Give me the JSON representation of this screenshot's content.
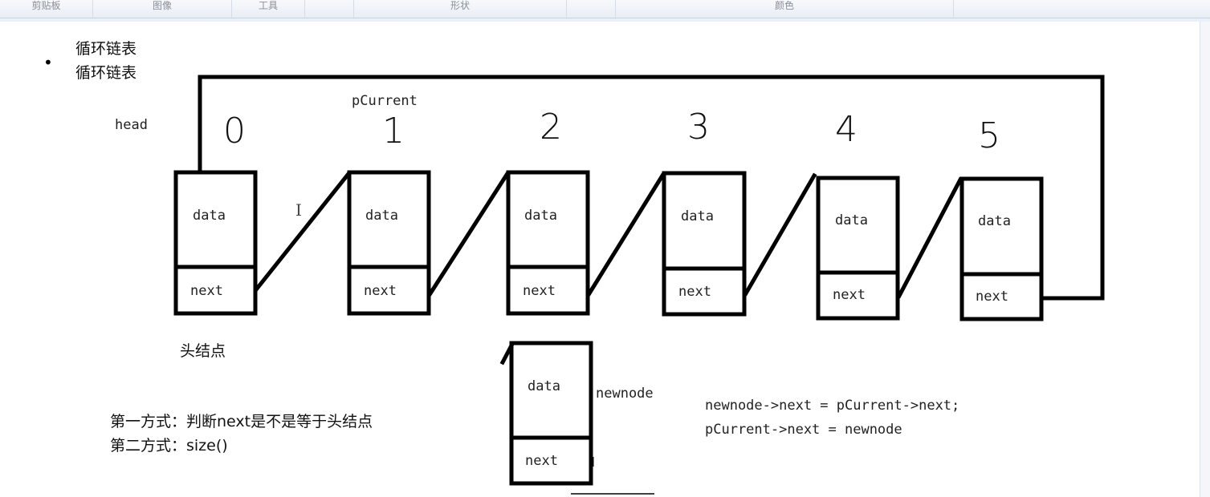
{
  "toolbar": {
    "groups": [
      {
        "label": "剪贴板"
      },
      {
        "label": "图像"
      },
      {
        "label": "工具"
      },
      {
        "label": ""
      },
      {
        "label": "形状"
      },
      {
        "label": ""
      },
      {
        "label": "颜色"
      }
    ]
  },
  "notes": {
    "line1": "循环链表",
    "line2": "循环链表",
    "bullet": "•"
  },
  "labels": {
    "head": "head",
    "pcurrent": "pCurrent",
    "head_node": "头结点",
    "newnode": "newnode"
  },
  "node_indices": [
    "0",
    "1",
    "2",
    "3",
    "4",
    "5"
  ],
  "nodes": [
    {
      "data": "data",
      "next": "next"
    },
    {
      "data": "data",
      "next": "next"
    },
    {
      "data": "data",
      "next": "next"
    },
    {
      "data": "data",
      "next": "next"
    },
    {
      "data": "data",
      "next": "next"
    },
    {
      "data": "data",
      "next": "next"
    }
  ],
  "new_node": {
    "data": "data",
    "next": "next"
  },
  "methods": {
    "first": "第一方式：判断next是不是等于头结点",
    "second": "第二方式：size()"
  },
  "code": {
    "line1": "newnode->next = pCurrent->next;",
    "line2": "pCurrent->next = newnode"
  },
  "colors": {
    "ink": "#000000",
    "ribbon_text": "#8a8f98"
  }
}
